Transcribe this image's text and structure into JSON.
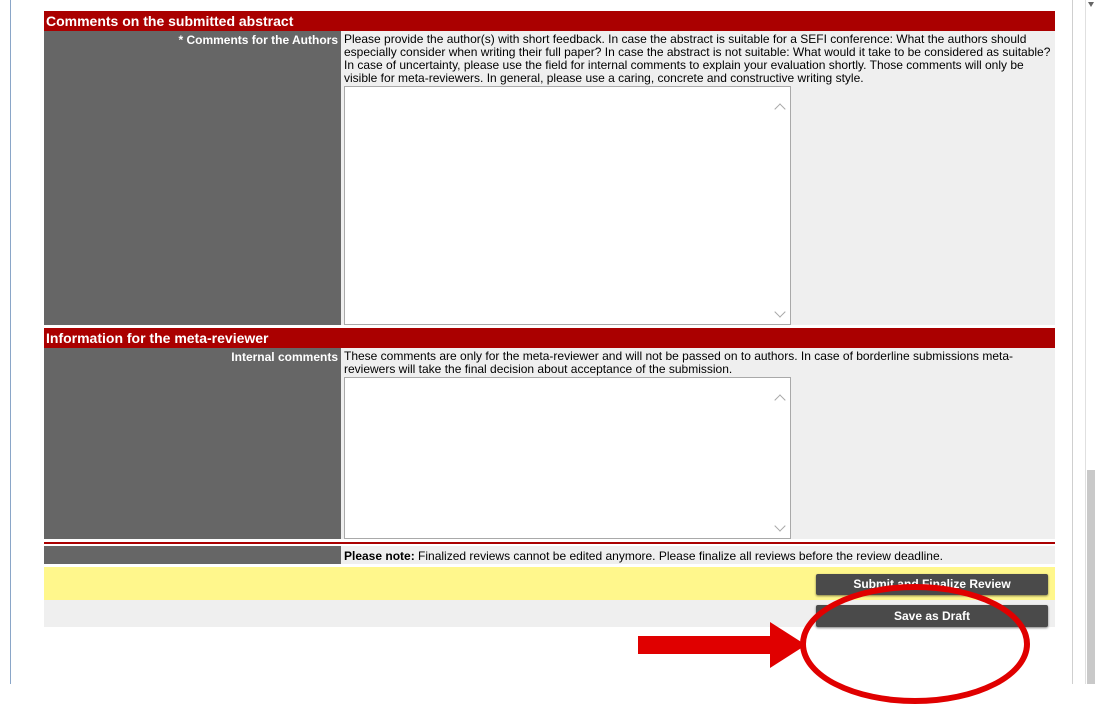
{
  "comments_section": {
    "header": "Comments on the submitted abstract",
    "authors_label": "* Comments for the Authors",
    "authors_instructions": "Please provide the author(s) with short feedback. In case the abstract is suitable for a SEFI conference: What the authors should especially consider when writing their full paper? In case the abstract is not suitable: What would it take to be considered as suitable? In case of uncertainty, please use the field for internal comments to explain your evaluation shortly. Those comments will only be visible for meta-reviewers. In general, please use a caring, concrete and constructive writing style.",
    "authors_value": ""
  },
  "meta_section": {
    "header": "Information for the meta-reviewer",
    "internal_label": "Internal comments",
    "internal_instructions": "These comments are only for the meta-reviewer and will not be passed on to authors. In case of borderline submissions meta-reviewers will take the final decision about acceptance of the submission.",
    "internal_value": ""
  },
  "note": {
    "prefix": "Please note:",
    "text": " Finalized reviews cannot be edited anymore. Please finalize all reviews before the review deadline."
  },
  "buttons": {
    "submit_label": "Submit and Finalize Review",
    "draft_label": "Save as Draft"
  },
  "colors": {
    "section_header": "#aa0000",
    "label_column": "#666666",
    "button_bar": "#fff78c",
    "annotation": "#e00000"
  }
}
